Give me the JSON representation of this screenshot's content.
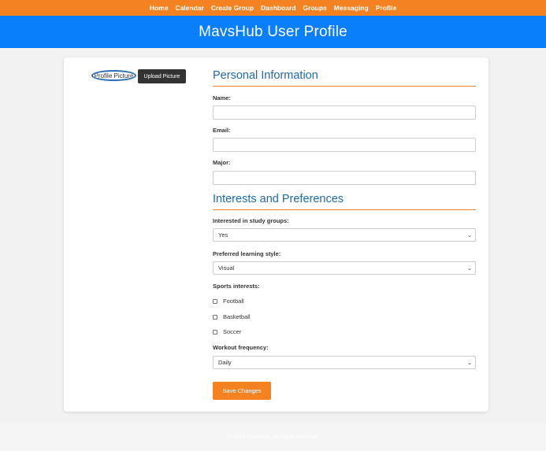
{
  "nav": {
    "items": [
      "Home",
      "Calendar",
      "Create Group",
      "Dashboard",
      "Groups",
      "Messaging",
      "Profile"
    ]
  },
  "header": {
    "title": "MavsHub User Profile"
  },
  "profile": {
    "picture_alt": "Profile Picture",
    "upload_label": "Upload Picture"
  },
  "personal": {
    "title": "Personal Information",
    "name_label": "Name:",
    "name_value": "",
    "email_label": "Email:",
    "email_value": "",
    "major_label": "Major:",
    "major_value": ""
  },
  "interests": {
    "title": "Interests and Preferences",
    "study_label": "Interested in study groups:",
    "study_value": "Yes",
    "learning_label": "Preferred learning style:",
    "learning_value": "Visual",
    "sports_label": "Sports interests:",
    "sports": [
      "Football",
      "Basketball",
      "Soccer"
    ],
    "workout_label": "Workout frequency:",
    "workout_value": "Daily"
  },
  "actions": {
    "save_label": "Save Changes"
  },
  "footer": {
    "text": "© 2024 MavsHub. All rights reserved."
  },
  "colors": {
    "accent": "#f58220",
    "brand": "#0a7ffb",
    "heading": "#1f6aa8"
  },
  "icons": {
    "select_arrow": "chevron-down-icon"
  }
}
